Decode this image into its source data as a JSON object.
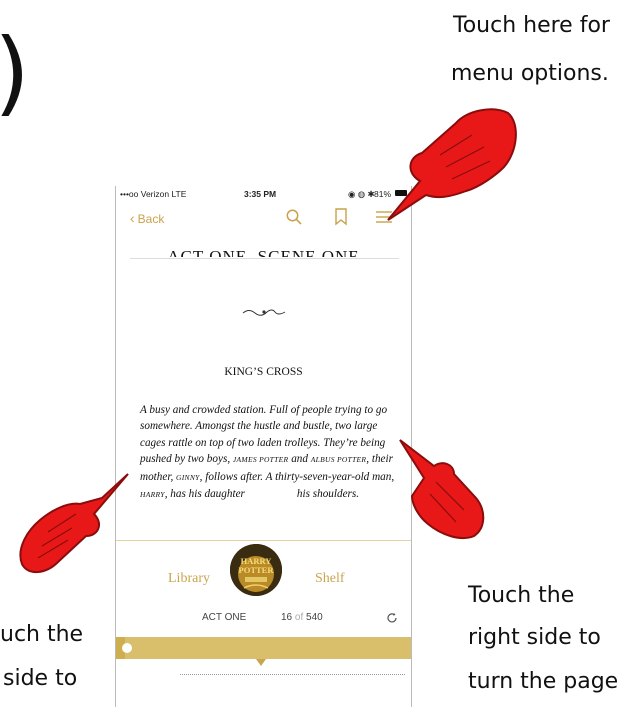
{
  "annotations": {
    "menu_line1": "Touch here for",
    "menu_line2": "menu options.",
    "right_line1": "Touch the",
    "right_line2": "right side to",
    "right_line3": "turn the page",
    "left_line1": "uch the",
    "left_line2": "side to",
    "paren": ")"
  },
  "status_bar": {
    "carrier": "•••oo Verizon  LTE",
    "time": "3:35 PM",
    "battery": "81%"
  },
  "nav": {
    "back_label": "Back",
    "icons": [
      "search-icon",
      "bookmark-icon",
      "menu-icon"
    ]
  },
  "book": {
    "scene_heading": "ACT ONE, SCENE ONE",
    "chapter_heading": "KING’S CROSS",
    "para_1": "A busy and crowded station. Full of people trying to go somewhere. Amongst the hustle and bustle, two large cages rattle on top of two laden trolleys. They’re being pushed by two boys, ",
    "name_1": "JAMES POTTER",
    "para_2": " and ",
    "name_2": "ALBUS POTTER",
    "para_3": ", their mother, ",
    "name_3": "GINNY",
    "para_4": ", follows after. A thirty-seven-year-old man, ",
    "name_4": "HARRY",
    "para_5": ", has his daughter",
    "para_6": "his shoulders."
  },
  "toolbar": {
    "library_label": "Library",
    "shelf_label": "Shelf",
    "cover_title_1": "HARRY",
    "cover_title_2": "POTTER"
  },
  "location": {
    "section": "ACT ONE",
    "page_current": "16",
    "page_of": "of",
    "page_total": "540",
    "progress_fraction": 0.03
  },
  "colors": {
    "accent": "#c9a550",
    "slider": "#d9bf6c",
    "hand": "#e81818"
  }
}
